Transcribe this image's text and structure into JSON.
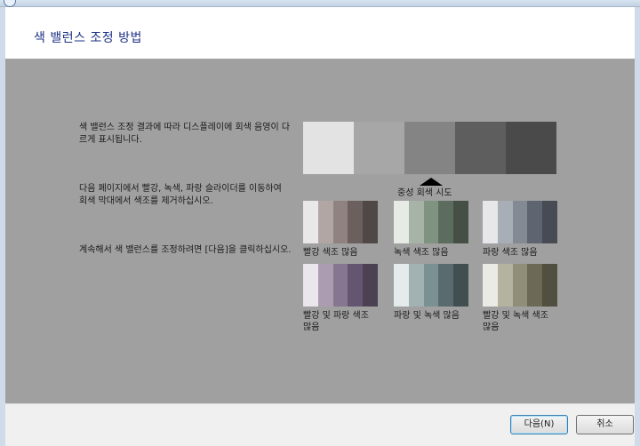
{
  "window": {
    "title": "색 밸런스 조정 방법"
  },
  "instructions": {
    "p1": "색 밸런스 조정 결과에 따라 디스플레이에 회색 음영이 다르게 표시됩니다.",
    "p2": "다음 페이지에서 빨강, 녹색, 파랑 슬라이더를 이동하여 회색 막대에서 색조를 제거하십시오.",
    "p3": "계속해서 색 밸런스를 조정하려면 [다음]을 클릭하십시오."
  },
  "neutral_gray": {
    "label": "중성 회색 시도",
    "colors": [
      "#e3e3e3",
      "#a7a7a7",
      "#848484",
      "#5e5e5e",
      "#4a4a4a"
    ]
  },
  "samples": [
    {
      "label": "빨강 색조 많음",
      "colors": [
        "#e9e7e7",
        "#b1a6a4",
        "#8f8280",
        "#6b605e",
        "#504846"
      ]
    },
    {
      "label": "녹색 색조 많음",
      "colors": [
        "#e6ebe6",
        "#a6b3a6",
        "#7f9480",
        "#5c6c5e",
        "#454f46"
      ]
    },
    {
      "label": "파랑 색조 많음",
      "colors": [
        "#e7e7ea",
        "#a8aeb6",
        "#838a94",
        "#5f6570",
        "#474b53"
      ]
    },
    {
      "label": "빨강 및 파랑 색조 많음",
      "colors": [
        "#eae6ec",
        "#ab9cb2",
        "#86768f",
        "#645670",
        "#4c4152"
      ]
    },
    {
      "label": "파랑 및 녹색 많음",
      "colors": [
        "#e5ebec",
        "#a2b2b3",
        "#7b9092",
        "#596b6e",
        "#424f51"
      ]
    },
    {
      "label": "빨강 및 녹색 색조 많음",
      "colors": [
        "#ebebe6",
        "#b4b39f",
        "#908e78",
        "#6c6a57",
        "#504f40"
      ]
    }
  ],
  "footer": {
    "next_label": "다음(N)",
    "cancel_label": "취소"
  }
}
